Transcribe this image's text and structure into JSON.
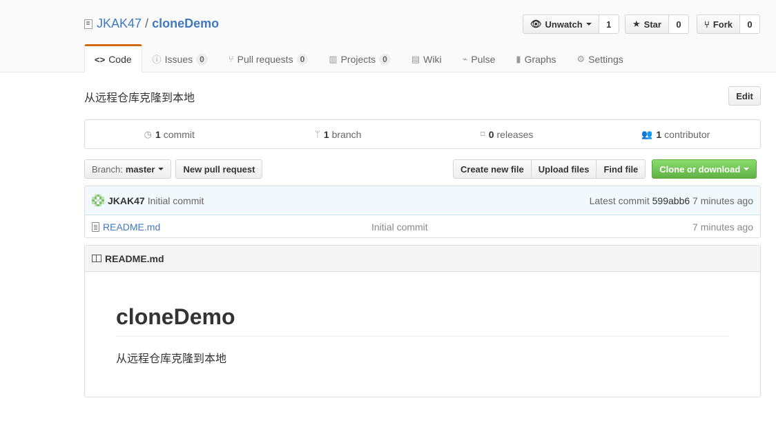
{
  "repo": {
    "owner": "JKAK47",
    "separator": "/",
    "name": "cloneDemo"
  },
  "actions": {
    "unwatch": {
      "label": "Unwatch",
      "count": "1"
    },
    "star": {
      "label": "Star",
      "count": "0"
    },
    "fork": {
      "label": "Fork",
      "count": "0"
    }
  },
  "tabs": [
    {
      "label": "Code",
      "icon": "code-icon",
      "active": true
    },
    {
      "label": "Issues",
      "count": "0",
      "icon": "issue-icon"
    },
    {
      "label": "Pull requests",
      "count": "0",
      "icon": "pull-request-icon"
    },
    {
      "label": "Projects",
      "count": "0",
      "icon": "project-icon"
    },
    {
      "label": "Wiki",
      "icon": "book-icon"
    },
    {
      "label": "Pulse",
      "icon": "pulse-icon"
    },
    {
      "label": "Graphs",
      "icon": "graph-icon"
    },
    {
      "label": "Settings",
      "icon": "gear-icon"
    }
  ],
  "description": "从远程仓库克隆到本地",
  "edit_label": "Edit",
  "summary": {
    "commits": {
      "count": "1",
      "label": "commit"
    },
    "branches": {
      "count": "1",
      "label": "branch"
    },
    "releases": {
      "count": "0",
      "label": "releases"
    },
    "contributors": {
      "count": "1",
      "label": "contributor"
    }
  },
  "branch": {
    "prefix": "Branch:",
    "value": "master"
  },
  "new_pr_label": "New pull request",
  "file_actions": {
    "create": "Create new file",
    "upload": "Upload files",
    "find": "Find file",
    "clone": "Clone or download"
  },
  "latest_commit": {
    "author": "JKAK47",
    "message": "Initial commit",
    "prefix": "Latest commit",
    "sha": "599abb6",
    "time": "7 minutes ago"
  },
  "files": [
    {
      "name": "README.md",
      "message": "Initial commit",
      "time": "7 minutes ago"
    }
  ],
  "readme": {
    "filename": "README.md",
    "heading": "cloneDemo",
    "body": "从远程仓库克隆到本地"
  },
  "colors": {
    "link": "#4078c0",
    "active_tab": "#d26911",
    "clone_green": "#60b044",
    "commit_bg": "#f2f9fc"
  }
}
